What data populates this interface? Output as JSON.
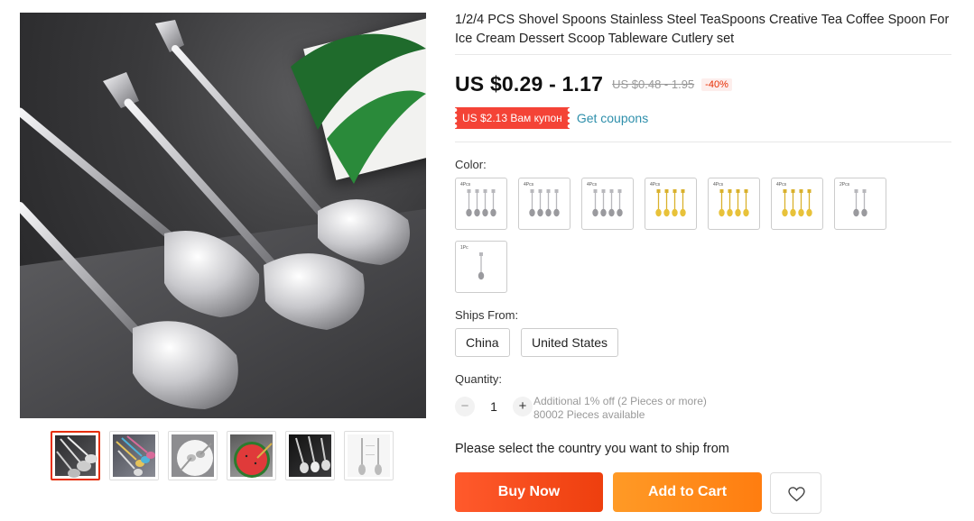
{
  "product": {
    "title": "1/2/4 PCS Shovel Spoons Stainless Steel TeaSpoons Creative Tea Coffee Spoon For Ice Cream Dessert Scoop Tableware Cutlery set"
  },
  "gallery": {
    "main_image_icon": "spoon-photo",
    "thumbnails": [
      {
        "name": "thumb-silver-spoons",
        "active": true
      },
      {
        "name": "thumb-colored-spoons",
        "active": false
      },
      {
        "name": "thumb-plate-spoons",
        "active": false
      },
      {
        "name": "thumb-watermelon",
        "active": false
      },
      {
        "name": "thumb-dark-spoons",
        "active": false
      },
      {
        "name": "thumb-white-spoons",
        "active": false
      }
    ]
  },
  "price": {
    "current": "US $0.29 - 1.17",
    "original": "US $0.48 - 1.95",
    "discount": "-40%"
  },
  "coupon": {
    "badge": "US $2.13 Вам купон",
    "link": "Get coupons"
  },
  "color": {
    "label": "Color:",
    "options": [
      {
        "tag": "4Pcs",
        "metal": "silver",
        "count": 4
      },
      {
        "tag": "4Pcs",
        "metal": "silver",
        "count": 4
      },
      {
        "tag": "4Pcs",
        "metal": "silver",
        "count": 4
      },
      {
        "tag": "4Pcs",
        "metal": "gold",
        "count": 4
      },
      {
        "tag": "4Pcs",
        "metal": "gold",
        "count": 4
      },
      {
        "tag": "4Pcs",
        "metal": "gold",
        "count": 4
      },
      {
        "tag": "2Pcs",
        "metal": "silver",
        "count": 2
      },
      {
        "tag": "1Pc",
        "metal": "silver",
        "count": 1
      }
    ]
  },
  "ships_from": {
    "label": "Ships From:",
    "options": [
      "China",
      "United States"
    ]
  },
  "quantity": {
    "label": "Quantity:",
    "value": "1",
    "minus": "−",
    "plus": "+",
    "additional": "Additional 1% off (2 Pieces or more)",
    "available": "80002 Pieces available"
  },
  "ship_message": "Please select the country you want to ship from",
  "actions": {
    "buy_now": "Buy Now",
    "add_to_cart": "Add to Cart",
    "wishlist_icon": "heart-icon"
  },
  "colors": {
    "accent_red": "#e62e04",
    "buy_orange_red": "#f0471a",
    "cart_orange": "#ff8a1b",
    "coupon_red": "#f44336",
    "link_blue": "#2e8fab"
  }
}
